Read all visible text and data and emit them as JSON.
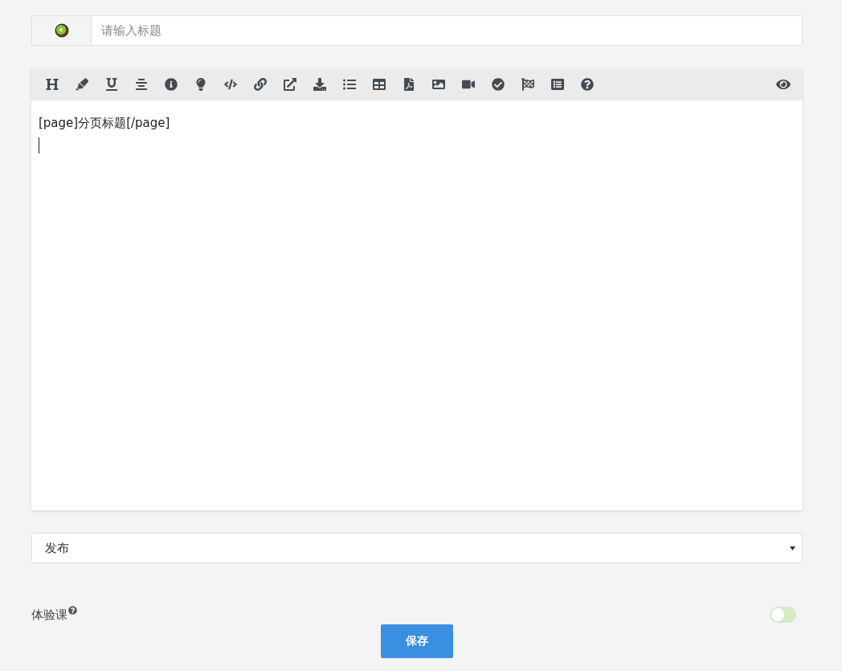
{
  "title_field": {
    "placeholder": "请输入标题"
  },
  "editor": {
    "lines": [
      "[page]分页标题[/page]"
    ]
  },
  "status_select": {
    "value": "发布"
  },
  "trial_toggle": {
    "label": "体验课",
    "on": false
  },
  "save_button": {
    "label": "保存"
  }
}
